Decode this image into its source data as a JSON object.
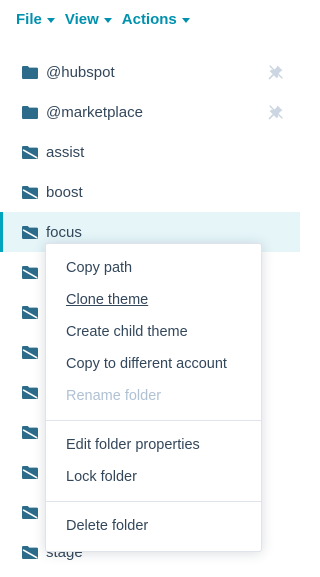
{
  "menubar": {
    "file_label": "File",
    "view_label": "View",
    "actions_label": "Actions"
  },
  "tree": {
    "items": [
      {
        "label": "@hubspot",
        "icon": "folder-icon",
        "pinned": true
      },
      {
        "label": "@marketplace",
        "icon": "folder-icon",
        "pinned": true
      },
      {
        "label": "assist",
        "icon": "theme-folder-icon"
      },
      {
        "label": "boost",
        "icon": "theme-folder-icon"
      },
      {
        "label": "focus",
        "icon": "theme-folder-icon",
        "selected": true
      },
      {
        "label": "",
        "icon": "theme-folder-icon"
      },
      {
        "label": "",
        "icon": "theme-folder-icon"
      },
      {
        "label": "",
        "icon": "theme-folder-icon"
      },
      {
        "label": "",
        "icon": "theme-folder-icon"
      },
      {
        "label": "",
        "icon": "theme-folder-icon"
      },
      {
        "label": "",
        "icon": "theme-folder-icon"
      },
      {
        "label": "",
        "icon": "theme-folder-icon"
      },
      {
        "label": "stage",
        "icon": "theme-folder-icon"
      }
    ]
  },
  "context_menu": {
    "copy_path": "Copy path",
    "clone_theme": "Clone theme",
    "create_child_theme": "Create child theme",
    "copy_to_account": "Copy to different account",
    "rename_folder": "Rename folder",
    "edit_folder_properties": "Edit folder properties",
    "lock_folder": "Lock folder",
    "delete_folder": "Delete folder"
  },
  "colors": {
    "accent": "#0091ae",
    "text": "#33475b",
    "disabled": "#b0c1d4",
    "selected_bg": "#e5f5f8",
    "selected_bar": "#00a4bd",
    "folder_icon": "#2c6c8a"
  }
}
